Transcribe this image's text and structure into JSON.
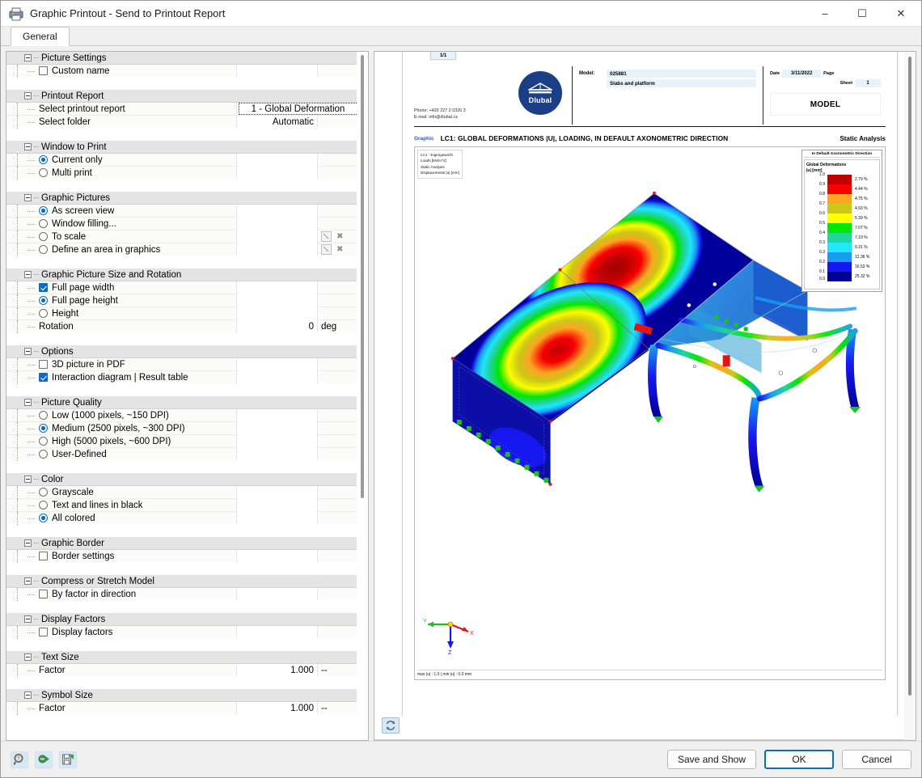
{
  "window": {
    "title": "Graphic Printout - Send to Printout Report",
    "icon": "printer-icon",
    "minimize": "–",
    "maximize": "☐",
    "close": "✕"
  },
  "tabs": [
    {
      "label": "General",
      "active": true
    }
  ],
  "options": {
    "groups": [
      {
        "name": "picture-settings",
        "title": "Picture Settings",
        "rows": [
          {
            "name": "custom-name",
            "control": "checkbox",
            "checked": false,
            "label": "Custom name",
            "value": "",
            "unit": ""
          }
        ]
      },
      {
        "name": "printout-report",
        "title": "Printout Report",
        "rows": [
          {
            "name": "select-printout-report",
            "control": "none",
            "label": "Select printout report",
            "value": "1 - Global Deformation",
            "valueStyle": "combo",
            "unit": ""
          },
          {
            "name": "select-folder",
            "control": "none",
            "label": "Select folder",
            "value": "Automatic",
            "valueStyle": "plain",
            "unit": ""
          }
        ]
      },
      {
        "name": "window-to-print",
        "title": "Window to Print",
        "rows": [
          {
            "name": "current-only",
            "control": "radio",
            "checked": true,
            "label": "Current only",
            "value": "",
            "unit": ""
          },
          {
            "name": "multi-print",
            "control": "radio",
            "checked": false,
            "label": "Multi print",
            "value": "",
            "unit": ""
          }
        ]
      },
      {
        "name": "graphic-pictures",
        "title": "Graphic Pictures",
        "rows": [
          {
            "name": "as-screen-view",
            "control": "radio",
            "checked": true,
            "label": "As screen view",
            "value": "",
            "unit": ""
          },
          {
            "name": "window-filling",
            "control": "radio",
            "checked": false,
            "label": "Window filling...",
            "value": "",
            "unit": ""
          },
          {
            "name": "to-scale",
            "control": "radio",
            "checked": false,
            "label": "To scale",
            "value": "",
            "unit": "",
            "actions": true
          },
          {
            "name": "define-area-in-graphics",
            "control": "radio",
            "checked": false,
            "label": "Define an area in graphics",
            "value": "",
            "unit": "",
            "actions": true
          }
        ]
      },
      {
        "name": "graphic-picture-size-and-rotation",
        "title": "Graphic Picture Size and Rotation",
        "rows": [
          {
            "name": "full-page-width",
            "control": "checkbox",
            "checked": true,
            "label": "Full page width",
            "value": "",
            "unit": ""
          },
          {
            "name": "full-page-height",
            "control": "radio",
            "checked": true,
            "label": "Full page height",
            "value": "",
            "unit": ""
          },
          {
            "name": "height",
            "control": "radio",
            "checked": false,
            "label": "Height",
            "value": "",
            "unit": ""
          },
          {
            "name": "rotation",
            "control": "none",
            "label": "Rotation",
            "value": "0",
            "valueStyle": "plain",
            "unit": "deg"
          }
        ]
      },
      {
        "name": "options",
        "title": "Options",
        "rows": [
          {
            "name": "3d-picture-in-pdf",
            "control": "checkbox",
            "checked": false,
            "label": "3D picture in PDF",
            "value": "",
            "unit": ""
          },
          {
            "name": "interaction-diagram-result-table",
            "control": "checkbox",
            "checked": true,
            "label": "Interaction diagram | Result table",
            "value": "",
            "unit": ""
          }
        ]
      },
      {
        "name": "picture-quality",
        "title": "Picture Quality",
        "rows": [
          {
            "name": "quality-low",
            "control": "radio",
            "checked": false,
            "label": "Low (1000 pixels, ~150 DPI)",
            "value": "",
            "unit": ""
          },
          {
            "name": "quality-medium",
            "control": "radio",
            "checked": true,
            "label": "Medium (2500 pixels, ~300 DPI)",
            "value": "",
            "unit": ""
          },
          {
            "name": "quality-high",
            "control": "radio",
            "checked": false,
            "label": "High (5000 pixels, ~600 DPI)",
            "value": "",
            "unit": ""
          },
          {
            "name": "quality-user-defined",
            "control": "radio",
            "checked": false,
            "label": "User-Defined",
            "value": "",
            "unit": ""
          }
        ]
      },
      {
        "name": "color",
        "title": "Color",
        "rows": [
          {
            "name": "grayscale",
            "control": "radio",
            "checked": false,
            "label": "Grayscale",
            "value": "",
            "unit": ""
          },
          {
            "name": "text-and-lines-in-black",
            "control": "radio",
            "checked": false,
            "label": "Text and lines in black",
            "value": "",
            "unit": ""
          },
          {
            "name": "all-colored",
            "control": "radio",
            "checked": true,
            "label": "All colored",
            "value": "",
            "unit": ""
          }
        ]
      },
      {
        "name": "graphic-border",
        "title": "Graphic Border",
        "rows": [
          {
            "name": "border-settings",
            "control": "checkbox",
            "checked": false,
            "label": "Border settings",
            "value": "",
            "unit": ""
          }
        ]
      },
      {
        "name": "compress-or-stretch-model",
        "title": "Compress or Stretch Model",
        "rows": [
          {
            "name": "by-factor-in-direction",
            "control": "checkbox",
            "checked": false,
            "label": "By factor in direction",
            "value": "",
            "unit": ""
          }
        ]
      },
      {
        "name": "display-factors",
        "title": "Display Factors",
        "rows": [
          {
            "name": "display-factors",
            "control": "checkbox",
            "checked": false,
            "label": "Display factors",
            "value": "",
            "unit": ""
          }
        ]
      },
      {
        "name": "text-size",
        "title": "Text Size",
        "rows": [
          {
            "name": "text-size-factor",
            "control": "none",
            "label": "Factor",
            "value": "1.000",
            "valueStyle": "plain",
            "unit": "--"
          }
        ]
      },
      {
        "name": "symbol-size",
        "title": "Symbol Size",
        "rows": [
          {
            "name": "symbol-size-factor",
            "control": "none",
            "label": "Factor",
            "value": "1.000",
            "valueStyle": "plain",
            "unit": "--"
          }
        ]
      }
    ]
  },
  "report": {
    "contact": {
      "phone": "Phone: +420 227 2 0320 3",
      "email": "E-mail: info@dlubal.cz"
    },
    "logo_text": "Dlubal",
    "model_key": "Model:",
    "model_number": "025881",
    "model_name": "Slabs and platform",
    "date_key": "Date",
    "date_value": "3/11/2022",
    "page_key": "Page",
    "page_value": "1/1",
    "sheet_key": "Sheet",
    "sheet_value": "1",
    "model_box_label": "MODEL",
    "tag": "Graphic",
    "title": "LC1: GLOBAL DEFORMATIONS |U|, LOADING, IN DEFAULT AXONOMETRIC DIRECTION",
    "analysis": "Static Analysis",
    "note_lines": [
      "LC1 - Eigengewicht",
      "Loads [kN/m^2]",
      "Static Analysis",
      "Displacements |u| [mm]"
    ],
    "status": "max |u| : 1.0 | min |u| : 0.0 mm",
    "axes": {
      "x": "X",
      "y": "Y",
      "z": "Z"
    },
    "legend": {
      "header": "In Default Axonometric Direction",
      "sub_line1": "Global Deformations",
      "sub_line2": "|u| [mm]",
      "ticks": [
        "1.0",
        "0.9",
        "0.8",
        "0.7",
        "0.6",
        "0.5",
        "0.4",
        "0.3",
        "0.3",
        "0.2",
        "0.1",
        "0.0"
      ],
      "bands": [
        {
          "color": "#c00000",
          "pct": "2.79 %"
        },
        {
          "color": "#fb0000",
          "pct": "4.44 %"
        },
        {
          "color": "#ffa51f",
          "pct": "4.75 %"
        },
        {
          "color": "#ccc916",
          "pct": "4.93 %"
        },
        {
          "color": "#ffff00",
          "pct": "5.39 %"
        },
        {
          "color": "#00e800",
          "pct": "7.07 %"
        },
        {
          "color": "#1fd69b",
          "pct": "7.10 %"
        },
        {
          "color": "#1fe8ff",
          "pct": "9.31 %"
        },
        {
          "color": "#189ef0",
          "pct": "12.36 %"
        },
        {
          "color": "#1717f2",
          "pct": "16.53 %"
        },
        {
          "color": "#00009a",
          "pct": "25.32 %"
        }
      ]
    }
  },
  "preview_toolbar": {
    "refresh_label": "refresh-icon"
  },
  "footer": {
    "icons": [
      {
        "name": "help-search-icon",
        "glyph": "?"
      },
      {
        "name": "export-icon",
        "glyph": "➤"
      },
      {
        "name": "save-settings-icon",
        "glyph": "▣"
      }
    ],
    "buttons": [
      {
        "name": "save-and-show-button",
        "label": "Save and Show",
        "primary": false
      },
      {
        "name": "ok-button",
        "label": "OK",
        "primary": true
      },
      {
        "name": "cancel-button",
        "label": "Cancel",
        "primary": false
      }
    ]
  },
  "colors": {
    "accent": "#0f6cbd",
    "brand": "#1b3f87",
    "header_band": "#e4e4e4"
  }
}
